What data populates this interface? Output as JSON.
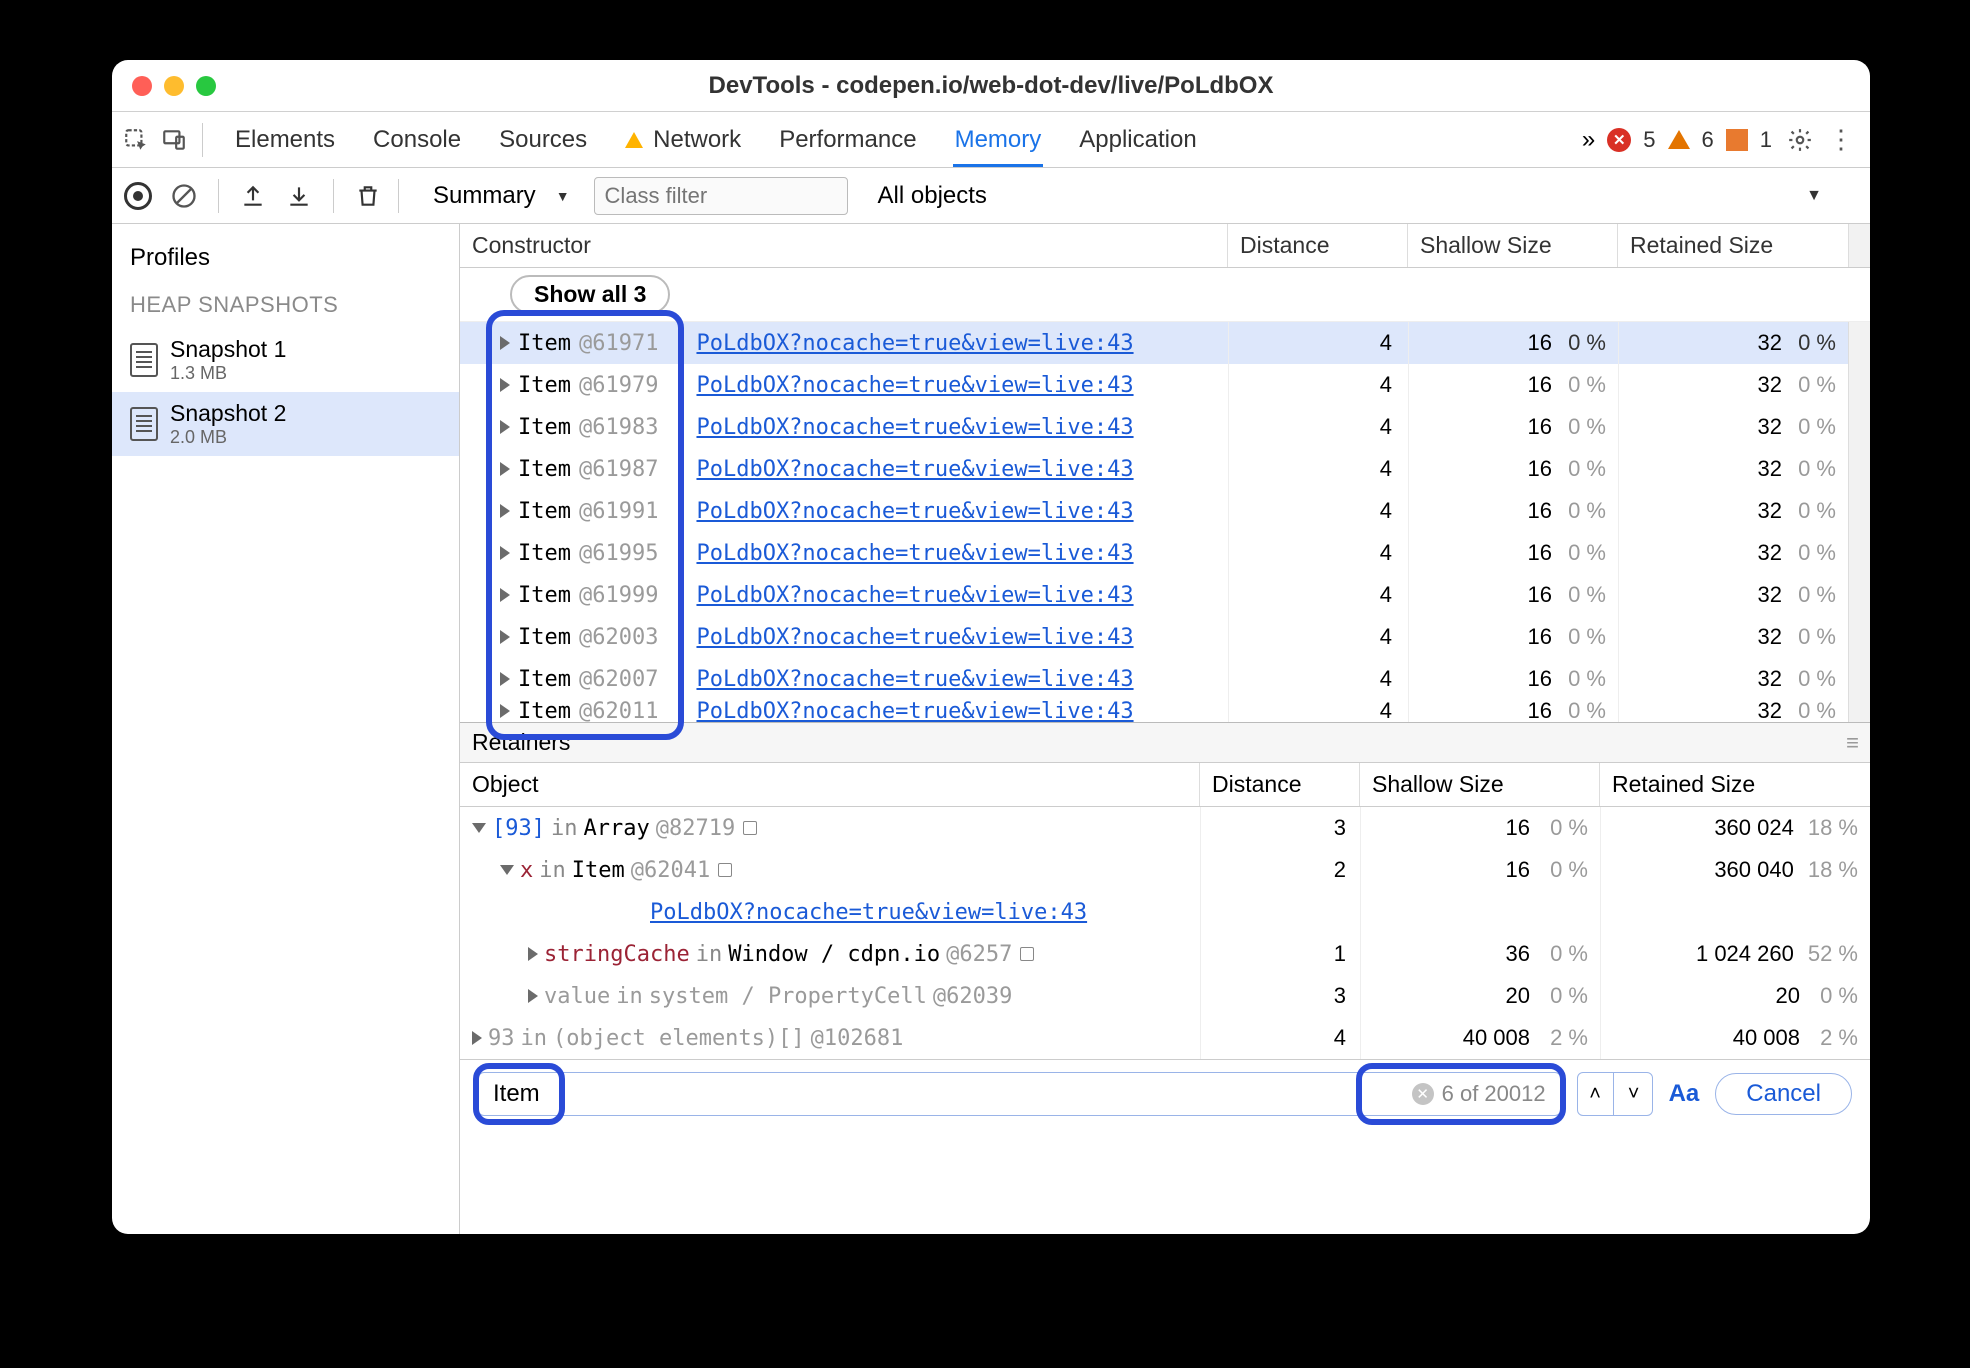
{
  "window": {
    "title": "DevTools - codepen.io/web-dot-dev/live/PoLdbOX"
  },
  "tabs": {
    "items": [
      "Elements",
      "Console",
      "Sources",
      "Network",
      "Performance",
      "Memory",
      "Application"
    ],
    "activeIndex": 5,
    "warningOn": [
      "Network"
    ],
    "overflow": "»"
  },
  "counts": {
    "errors": "5",
    "warnings": "6",
    "issues": "1"
  },
  "toolbar": {
    "view": "Summary",
    "filterPlaceholder": "Class filter",
    "scope": "All objects"
  },
  "sidebar": {
    "title": "Profiles",
    "section": "HEAP SNAPSHOTS",
    "snaps": [
      {
        "name": "Snapshot 1",
        "size": "1.3 MB"
      },
      {
        "name": "Snapshot 2",
        "size": "2.0 MB"
      }
    ],
    "activeIndex": 1
  },
  "gridHeaders": {
    "constructor": "Constructor",
    "distance": "Distance",
    "shallow": "Shallow Size",
    "retained": "Retained Size"
  },
  "showAll": "Show all 3",
  "link": "PoLdbOX?nocache=true&view=live:43",
  "items": [
    {
      "name": "Item",
      "id": "@61971",
      "selected": true,
      "dist": "4",
      "sh": "16",
      "shp": "0 %",
      "rt": "32",
      "rtp": "0 %"
    },
    {
      "name": "Item",
      "id": "@61979",
      "selected": false,
      "dist": "4",
      "sh": "16",
      "shp": "0 %",
      "rt": "32",
      "rtp": "0 %"
    },
    {
      "name": "Item",
      "id": "@61983",
      "selected": false,
      "dist": "4",
      "sh": "16",
      "shp": "0 %",
      "rt": "32",
      "rtp": "0 %"
    },
    {
      "name": "Item",
      "id": "@61987",
      "selected": false,
      "dist": "4",
      "sh": "16",
      "shp": "0 %",
      "rt": "32",
      "rtp": "0 %"
    },
    {
      "name": "Item",
      "id": "@61991",
      "selected": false,
      "dist": "4",
      "sh": "16",
      "shp": "0 %",
      "rt": "32",
      "rtp": "0 %"
    },
    {
      "name": "Item",
      "id": "@61995",
      "selected": false,
      "dist": "4",
      "sh": "16",
      "shp": "0 %",
      "rt": "32",
      "rtp": "0 %"
    },
    {
      "name": "Item",
      "id": "@61999",
      "selected": false,
      "dist": "4",
      "sh": "16",
      "shp": "0 %",
      "rt": "32",
      "rtp": "0 %"
    },
    {
      "name": "Item",
      "id": "@62003",
      "selected": false,
      "dist": "4",
      "sh": "16",
      "shp": "0 %",
      "rt": "32",
      "rtp": "0 %"
    },
    {
      "name": "Item",
      "id": "@62007",
      "selected": false,
      "dist": "4",
      "sh": "16",
      "shp": "0 %",
      "rt": "32",
      "rtp": "0 %"
    },
    {
      "name": "Item",
      "id": "@62011",
      "selected": false,
      "dist": "4",
      "sh": "16",
      "shp": "0 %",
      "rt": "32",
      "rtp": "0 %",
      "partial": true
    }
  ],
  "retainers": {
    "title": "Retainers",
    "headers": {
      "object": "Object",
      "distance": "Distance",
      "shallow": "Shallow Size",
      "retained": "Retained Size"
    },
    "rows": [
      {
        "indent": 0,
        "arrow": "down",
        "segments": [
          {
            "t": "[93]",
            "c": "idx-br"
          },
          {
            "t": " in ",
            "c": "kw-in"
          },
          {
            "t": "Array ",
            "c": ""
          },
          {
            "t": "@82719",
            "c": "dim"
          },
          {
            "t": "□",
            "c": "box"
          }
        ],
        "dist": "3",
        "sh": "16",
        "shp": "0 %",
        "rt": "360 024",
        "rtp": "18 %"
      },
      {
        "indent": 1,
        "arrow": "down",
        "segments": [
          {
            "t": "x",
            "c": "prop"
          },
          {
            "t": " in ",
            "c": "kw-in"
          },
          {
            "t": "Item ",
            "c": ""
          },
          {
            "t": "@62041",
            "c": "dim"
          },
          {
            "t": "□",
            "c": "box"
          }
        ],
        "dist": "2",
        "sh": "16",
        "shp": "0 %",
        "rt": "360 040",
        "rtp": "18 %"
      },
      {
        "indent": 0,
        "arrow": "",
        "linkOnly": true
      },
      {
        "indent": 2,
        "arrow": "right",
        "segments": [
          {
            "t": "stringCache",
            "c": "prop"
          },
          {
            "t": " in ",
            "c": "kw-in"
          },
          {
            "t": "Window / cdpn.io ",
            "c": ""
          },
          {
            "t": "@6257",
            "c": "dim"
          },
          {
            "t": "□",
            "c": "box"
          }
        ],
        "dist": "1",
        "sh": "36",
        "shp": "0 %",
        "rt": "1 024 260",
        "rtp": "52 %"
      },
      {
        "indent": 2,
        "arrow": "right",
        "segments": [
          {
            "t": "value",
            "c": "dim"
          },
          {
            "t": " in ",
            "c": "dim"
          },
          {
            "t": "system / PropertyCell ",
            "c": "dim"
          },
          {
            "t": "@62039",
            "c": "dim"
          }
        ],
        "dist": "3",
        "sh": "20",
        "shp": "0 %",
        "rt": "20",
        "rtp": "0 %"
      },
      {
        "indent": 0,
        "arrow": "right",
        "segments": [
          {
            "t": "93",
            "c": "dim"
          },
          {
            "t": " in ",
            "c": "dim"
          },
          {
            "t": "(object elements)[] ",
            "c": "dim"
          },
          {
            "t": "@102681",
            "c": "dim"
          }
        ],
        "dist": "4",
        "sh": "40 008",
        "shp": "2 %",
        "rt": "40 008",
        "rtp": "2 %"
      }
    ]
  },
  "search": {
    "value": "Item",
    "matches": "6 of 20012",
    "aa": "Aa",
    "cancel": "Cancel"
  }
}
